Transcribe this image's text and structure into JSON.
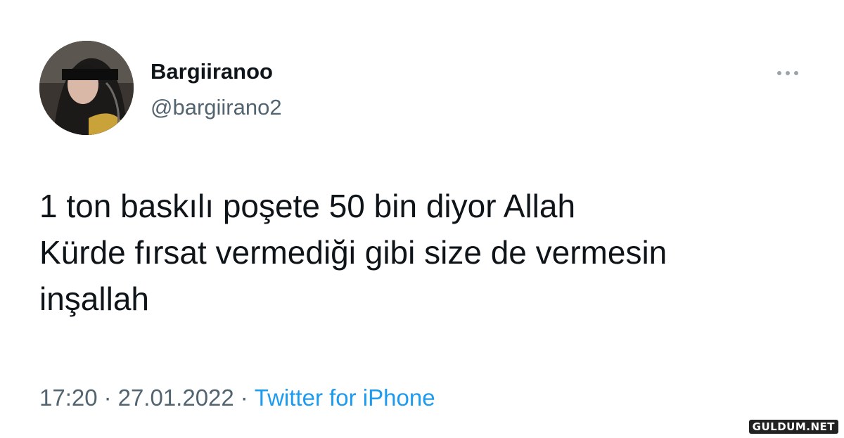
{
  "tweet": {
    "display_name": "Bargiiranoo",
    "handle": "@bargiirano2",
    "text": "1 ton baskılı poşete 50 bin diyor Allah\nKürde fırsat vermediği gibi size de vermesin\ninşallah",
    "time": "17:20",
    "separator": "·",
    "date": "27.01.2022",
    "source": "Twitter for iPhone",
    "avatar_icon": "profile-photo",
    "more_icon": "more-options-icon"
  },
  "watermark": {
    "text": "GULDUM.NET"
  },
  "colors": {
    "text_primary": "#0f1419",
    "text_secondary": "#536471",
    "link": "#1d9bf0",
    "background": "#ffffff"
  }
}
